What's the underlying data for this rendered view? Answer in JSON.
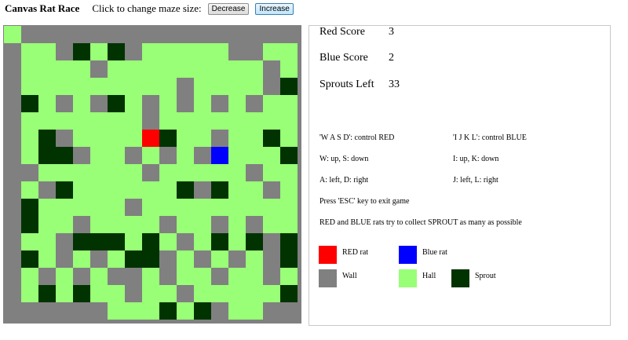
{
  "header": {
    "title": "Canvas Rat Race",
    "size_label": "Click to change maze size:",
    "decrease_label": "Decrease",
    "increase_label": "Increase"
  },
  "colors": {
    "wall": "#808080",
    "hall": "#99ff77",
    "sprout": "#003300",
    "red_rat": "#ff0000",
    "blue_rat": "#0000ff"
  },
  "maze": {
    "rows": [
      "HWWWWWWWWWWWWWWWWW",
      "WHHWSHSWHHHHHWWHHW",
      "WHHHHWHHHHHHHHHWHW",
      "WHHHHHHHHHWHHHHWSW",
      "WSHWHWSHWHWHWHWHHW",
      "WHHHHHHHWHHHHHHHHW",
      "WHSWHHHHRSHHWHHSHW",
      "WHSSWHHWHWHWBHHHSW",
      "WWHHHHHHWHHHHHWHHW",
      "WHWSHHHHHHSWSHHWHW",
      "WSHHHHHWHHHHHHHHHW",
      "WSHHWHHHHWHHWHWHHW",
      "WHHWSSSHSHWHSHSWSW",
      "WSHWHWHSSWHWHWHWSW",
      "WHWHWHWWHWHHWHHWHW",
      "WHSHSHHWHHWHHHHHSW",
      "WWWWWWHHHSHSWHHWWW",
      "WWWWWWWWWWWWWWWWWW"
    ]
  },
  "scores": [
    {
      "label": "Red Score",
      "value": "3"
    },
    {
      "label": "Blue Score",
      "value": "2"
    },
    {
      "label": "Sprouts Left",
      "value": "33"
    }
  ],
  "instructions": {
    "red_keys": "'W A S D': control RED",
    "blue_keys": "'I J K L': control BLUE",
    "red_updown": "W: up, S: down",
    "blue_updown": "I: up, K: down",
    "red_leftright": "A: left, D: right",
    "blue_leftright": "J: left, L: right",
    "exit": "Press 'ESC' key to exit game",
    "goal": "RED and BLUE rats try to collect SPROUT as many as possible"
  },
  "legend": {
    "red_rat": "RED rat",
    "blue_rat": "Blue rat",
    "wall": "Wall",
    "hall": "Hall",
    "sprout": "Sprout"
  }
}
